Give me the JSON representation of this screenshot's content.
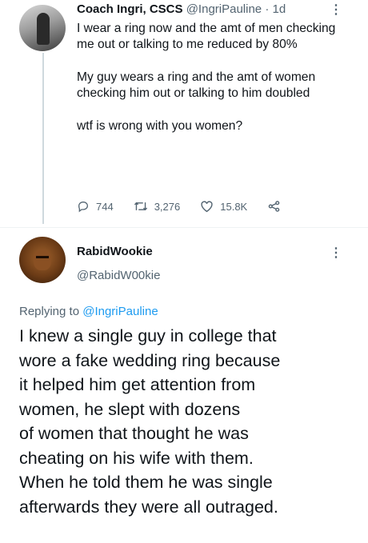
{
  "tweet": {
    "author_name": "Coach Ingri, CSCS",
    "author_handle": "@IngriPauline",
    "separator": "·",
    "time": "1d",
    "paragraphs": [
      "I wear a ring now and the amt of men checking me out or talking to me reduced by 80%",
      "My guy wears a ring and the amt of women checking him out or talking to him doubled",
      "wtf is wrong with you women?"
    ],
    "replies_count": "744",
    "retweets_count": "3,276",
    "likes_count": "15.8K",
    "more_icon": "more-vertical-icon",
    "reply_icon": "reply-icon",
    "retweet_icon": "retweet-icon",
    "like_icon": "heart-icon",
    "share_icon": "share-icon"
  },
  "reply": {
    "author_name": "RabidWookie",
    "author_handle": "@RabidW00kie",
    "replying_prefix": "Replying to",
    "replying_mention": "@IngriPauline",
    "lines": [
      "I knew a single guy in college that",
      "wore a fake wedding ring because",
      "it helped him get attention from",
      "women, he slept with dozens",
      "of women that thought he was",
      "cheating on his wife with them.",
      "When he told them he was single",
      "afterwards they were all outraged."
    ]
  },
  "colors": {
    "text": "#0f1419",
    "secondary": "#536471",
    "accent": "#1d9bf0"
  }
}
